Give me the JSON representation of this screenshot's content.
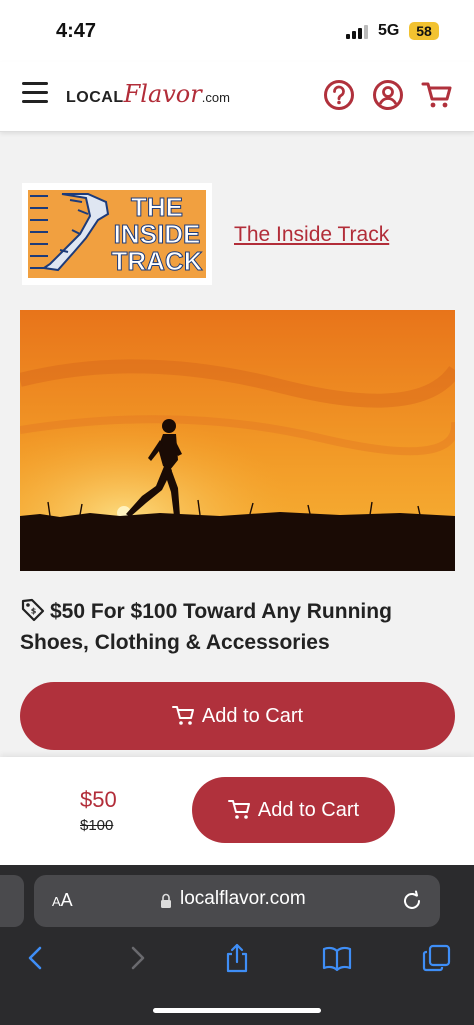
{
  "status_bar": {
    "time": "4:47",
    "network": "5G",
    "battery": "58"
  },
  "header": {
    "logo_part1": "LOCAL",
    "logo_part2": "Flavor",
    "logo_part3": ".com"
  },
  "merchant": {
    "logo_line1": "THE",
    "logo_line2": "INSIDE",
    "logo_line3": "TRACK",
    "name": "The Inside Track"
  },
  "deal": {
    "title": "$50 For $100 Toward Any Running Shoes, Clothing & Accessories"
  },
  "buttons": {
    "add_to_cart": "Add to Cart"
  },
  "pricing": {
    "price": "$50",
    "original_price": "$100"
  },
  "browser": {
    "text_size_small": "A",
    "text_size_large": "A",
    "url": "localflavor.com"
  },
  "colors": {
    "brand_red": "#b0313c",
    "hero_orange": "#f08a1e",
    "logo_orange": "#f1a040"
  }
}
